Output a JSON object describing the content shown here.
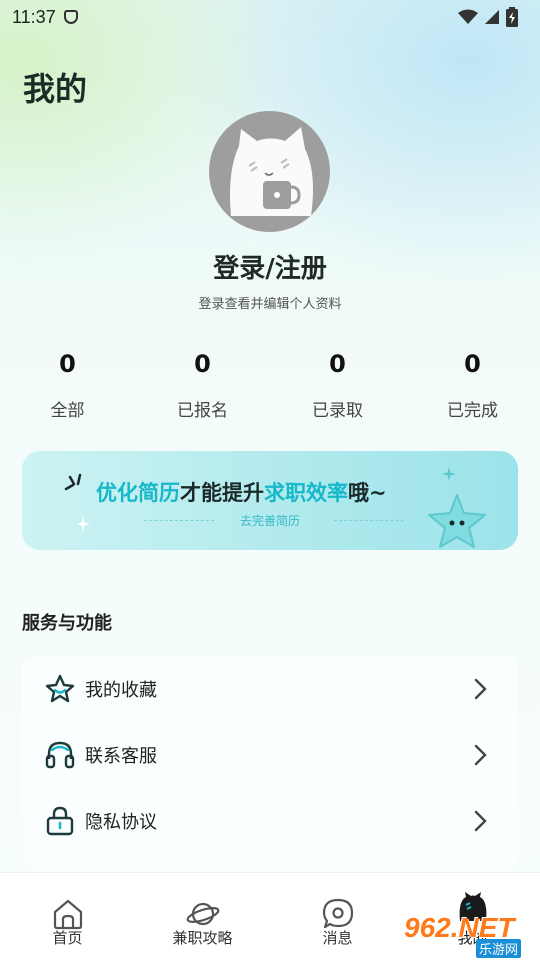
{
  "status_bar": {
    "time": "11:37"
  },
  "header": {
    "title": "我的"
  },
  "profile": {
    "login_title": "登录/注册",
    "login_subtitle": "登录查看并编辑个人资料"
  },
  "stats": [
    {
      "count": "0",
      "label": "全部"
    },
    {
      "count": "0",
      "label": "已报名"
    },
    {
      "count": "0",
      "label": "已录取"
    },
    {
      "count": "0",
      "label": "已完成"
    }
  ],
  "banner": {
    "part1": "优化简历",
    "part2": "才能提升",
    "part3": "求职效率",
    "part4": "哦~",
    "link": "去完善简历"
  },
  "services": {
    "title": "服务与功能",
    "items": [
      {
        "label": "我的收藏",
        "icon": "star-icon"
      },
      {
        "label": "联系客服",
        "icon": "headset-icon"
      },
      {
        "label": "隐私协议",
        "icon": "lock-icon"
      }
    ]
  },
  "bottom_nav": [
    {
      "label": "首页",
      "icon": "home-icon"
    },
    {
      "label": "兼职攻略",
      "icon": "planet-icon"
    },
    {
      "label": "消息",
      "icon": "message-icon"
    },
    {
      "label": "我的",
      "icon": "profile-icon"
    }
  ],
  "watermark": {
    "text": "962.NET",
    "sub": "乐游网"
  },
  "colors": {
    "accent": "#16b8c9",
    "icon_dark": "#1e3a3d"
  }
}
